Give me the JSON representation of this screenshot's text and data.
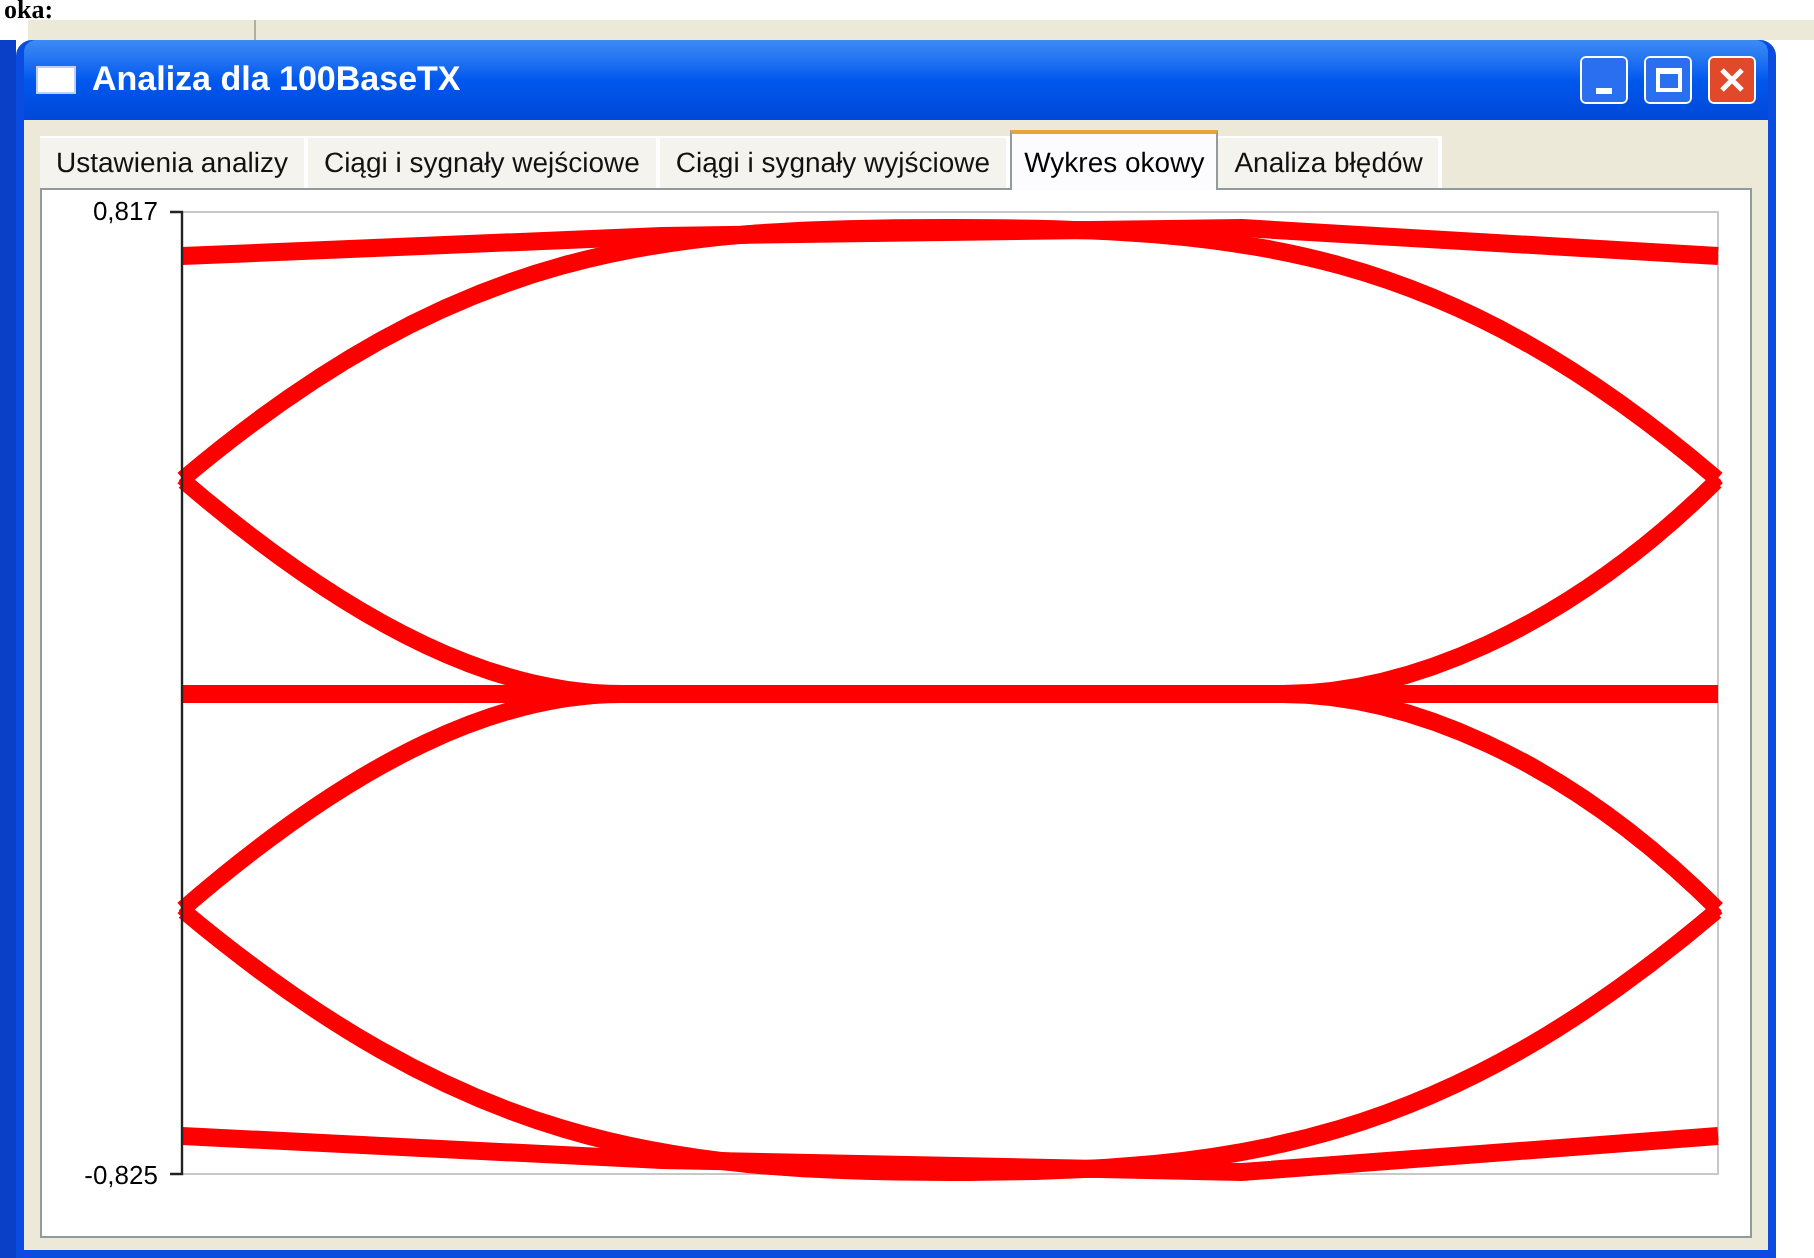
{
  "document": {
    "text": "oka:"
  },
  "window": {
    "title": "Analiza dla 100BaseTX"
  },
  "tabs": [
    {
      "label": "Ustawienia analizy",
      "selected": false
    },
    {
      "label": "Ciągi i sygnały wejściowe",
      "selected": false
    },
    {
      "label": "Ciągi i sygnały wyjściowe",
      "selected": false
    },
    {
      "label": "Wykres okowy",
      "selected": true
    },
    {
      "label": "Analiza błędów",
      "selected": false
    }
  ],
  "plot": {
    "y_max_label": "0,817",
    "y_min_label": "-0,825"
  }
}
